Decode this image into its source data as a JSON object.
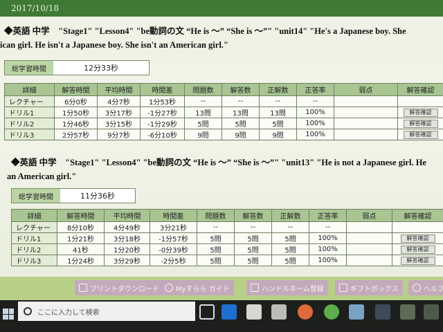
{
  "date": "2017/10/18",
  "section1": {
    "heading_line1": "◆英語 中学　\"Stage1\" \"Lesson4\" \"be動詞の文 “He is ～” “She is ～”\" \"unit14\" \"He's a Japanese boy. She",
    "heading_line2": "ican girl. He isn't a Japanese boy. She isn't an American girl.\"",
    "total_label": "総学習時間",
    "total_value": "12分33秒",
    "columns": [
      "詳細",
      "解答時間",
      "平均時間",
      "時間差",
      "問題数",
      "解答数",
      "正解数",
      "正答率",
      "弱点",
      "解答確認"
    ],
    "rows": [
      {
        "name": "レクチャー",
        "time": "6分0秒",
        "avg": "4分7秒",
        "diff": "1分53秒",
        "q": "--",
        "ans": "--",
        "ok": "--",
        "rate": "--",
        "weak": "",
        "check": ""
      },
      {
        "name": "ドリル1",
        "time": "1分50秒",
        "avg": "3分17秒",
        "diff": "-1分27秒",
        "q": "13問",
        "ans": "13問",
        "ok": "13問",
        "rate": "100%",
        "weak": "",
        "check": "解答確認"
      },
      {
        "name": "ドリル2",
        "time": "1分46秒",
        "avg": "3分15秒",
        "diff": "-1分29秒",
        "q": "5問",
        "ans": "5問",
        "ok": "5問",
        "rate": "100%",
        "weak": "",
        "check": "解答確認"
      },
      {
        "name": "ドリル3",
        "time": "2分57秒",
        "avg": "9分7秒",
        "diff": "-6分10秒",
        "q": "9問",
        "ans": "9問",
        "ok": "9問",
        "rate": "100%",
        "weak": "",
        "check": "解答確認"
      }
    ]
  },
  "section2": {
    "heading_line1": "◆英語 中学　\"Stage1\" \"Lesson4\" \"be動詞の文 “He is ～” “She is ～”\" \"unit13\" \"He is not a Japanese girl. He",
    "heading_line2": "an American girl.\"",
    "total_label": "総学習時間",
    "total_value": "11分36秒",
    "columns": [
      "詳細",
      "解答時間",
      "平均時間",
      "時間差",
      "問題数",
      "解答数",
      "正解数",
      "正答率",
      "弱点",
      "解答確認"
    ],
    "rows": [
      {
        "name": "レクチャー",
        "time": "8分10秒",
        "avg": "4分49秒",
        "diff": "3分21秒",
        "q": "--",
        "ans": "--",
        "ok": "--",
        "rate": "--",
        "weak": "",
        "check": ""
      },
      {
        "name": "ドリル1",
        "time": "1分21秒",
        "avg": "3分18秒",
        "diff": "-1分57秒",
        "q": "5問",
        "ans": "5問",
        "ok": "5問",
        "rate": "100%",
        "weak": "",
        "check": "解答確認"
      },
      {
        "name": "ドリル2",
        "time": "41秒",
        "avg": "1分20秒",
        "diff": "-0分39秒",
        "q": "5問",
        "ans": "5問",
        "ok": "5問",
        "rate": "100%",
        "weak": "",
        "check": "解答確認"
      },
      {
        "name": "ドリル3",
        "time": "1分24秒",
        "avg": "3分29秒",
        "diff": "-2分5秒",
        "q": "5問",
        "ans": "5問",
        "ok": "5問",
        "rate": "100%",
        "weak": "",
        "check": "解答確認"
      }
    ]
  },
  "menu": {
    "print": "プリントダウンロード",
    "guide": "Myすらら ガイド",
    "home": "ハンドルネーム登録",
    "gift": "ギフトボックス",
    "help": "ヘルプ"
  },
  "taskbar": {
    "search_placeholder": "ここに入力して検索"
  },
  "colors": {
    "header_bar": "#3f7a35",
    "table_header": "#a8c592",
    "positive_diff": "#d4302a",
    "negative_diff": "#2a66c4"
  }
}
